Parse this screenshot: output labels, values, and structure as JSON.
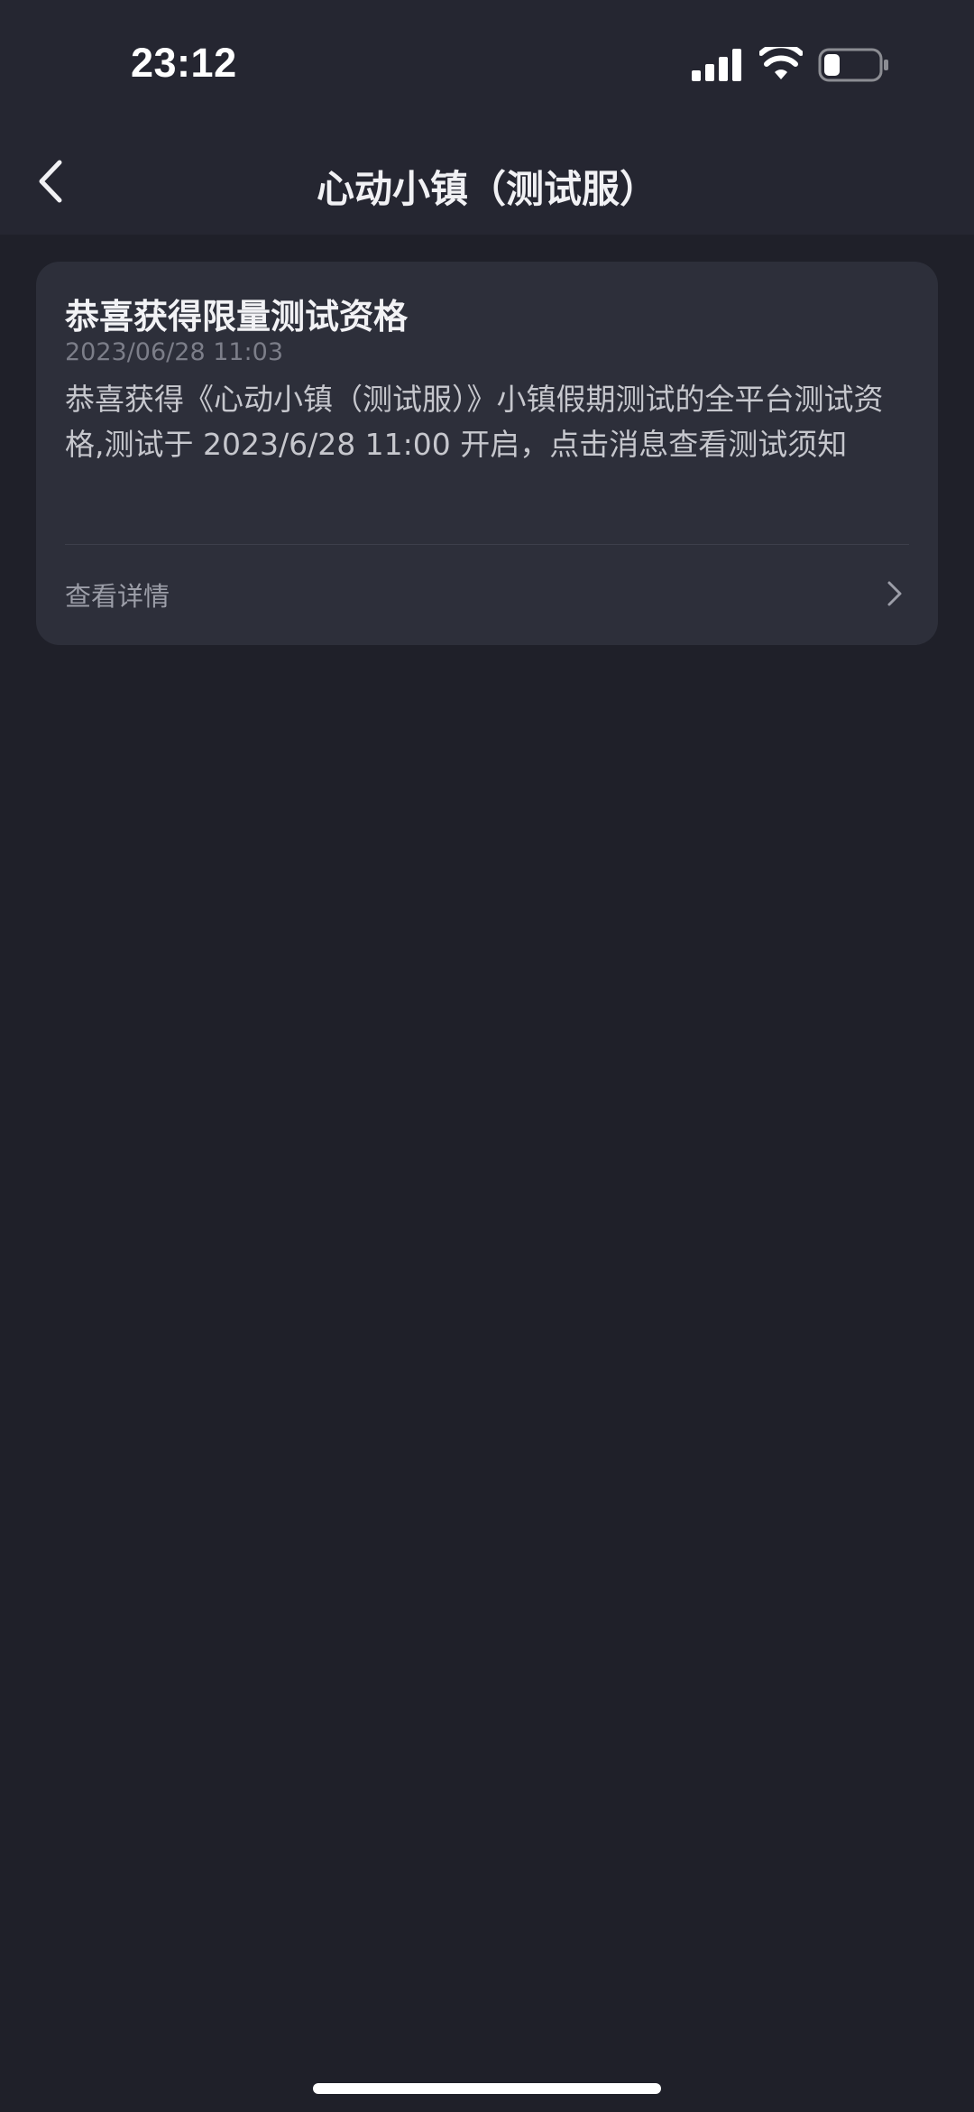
{
  "status_bar": {
    "time": "23:12",
    "signal_icon": "cellular-signal-icon",
    "wifi_icon": "wifi-icon",
    "battery_icon": "battery-icon",
    "battery_level": 0.3
  },
  "nav": {
    "back_icon": "chevron-left-icon",
    "title": "心动小镇（测试服）"
  },
  "message": {
    "title": "恭喜获得限量测试资格",
    "time": "2023/06/28 11:03",
    "body": "恭喜获得《心动小镇（测试服）》小镇假期测试的全平台测试资格,测试于 2023/6/28 11:00 开启，点击消息查看测试须知",
    "link_label": "查看详情",
    "link_icon": "chevron-right-icon"
  },
  "colors": {
    "background": "#1f2029",
    "header": "#252631",
    "card": "#2d2f3a",
    "text_primary": "#f2f2f5",
    "text_secondary": "#c6c7cd",
    "text_muted": "#7c7e89"
  }
}
